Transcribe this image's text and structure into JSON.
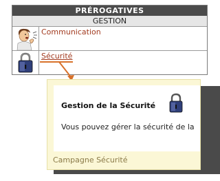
{
  "panel": {
    "title": "PRÉROGATIVES",
    "subtitle": "GESTION",
    "rows": [
      {
        "label": "Communication",
        "icon": "person-speaking-icon"
      },
      {
        "label": "Sécurité",
        "icon": "padlock-icon"
      }
    ]
  },
  "popup": {
    "title": "Gestion de la Sécurité",
    "text": "Vous pouvez gérer la sécurité de la",
    "footer": "Campagne Sécurité",
    "icon": "padlock-icon"
  },
  "colors": {
    "link": "#a23b20",
    "arrow": "#d8712a",
    "popup_bg": "#fbf7d6",
    "header_bg": "#4b4b4b"
  }
}
